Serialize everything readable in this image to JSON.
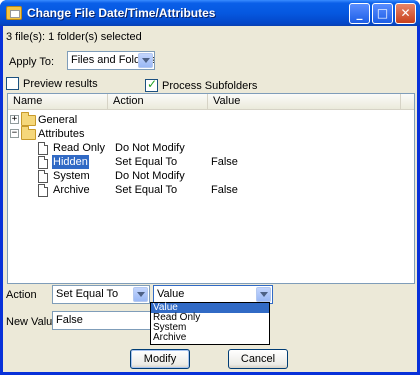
{
  "window": {
    "title": "Change File Date/Time/Attributes",
    "buttons": {
      "minimize": "_",
      "maximize": "□",
      "close": "✕"
    }
  },
  "summary": "3 file(s): 1 folder(s) selected",
  "apply_to": {
    "label": "Apply To:",
    "value": "Files and Folders"
  },
  "preview": {
    "label": "Preview results",
    "checked": false
  },
  "process_subfolders": {
    "label": "Process Subfolders",
    "checked": true
  },
  "list": {
    "columns": [
      "Name",
      "Action",
      "Value"
    ],
    "groups": [
      {
        "name": "General",
        "expander": "+",
        "expanded": false,
        "children": []
      },
      {
        "name": "Attributes",
        "expander": "−",
        "expanded": true,
        "children": [
          {
            "name": "Read Only",
            "action": "Do Not Modify",
            "value": "",
            "selected": false
          },
          {
            "name": "Hidden",
            "action": "Set Equal To",
            "value": "False",
            "selected": true
          },
          {
            "name": "System",
            "action": "Do Not Modify",
            "value": "",
            "selected": false
          },
          {
            "name": "Archive",
            "action": "Set Equal To",
            "value": "False",
            "selected": false
          }
        ]
      }
    ]
  },
  "action": {
    "label": "Action",
    "value": "Set Equal To"
  },
  "value_combo": {
    "value": "Value",
    "options": [
      "Value",
      "Read Only",
      "System",
      "Archive"
    ],
    "highlighted": 0
  },
  "new_value": {
    "label": "New Value",
    "value": "False"
  },
  "buttons": {
    "modify": "Modify",
    "cancel": "Cancel"
  }
}
